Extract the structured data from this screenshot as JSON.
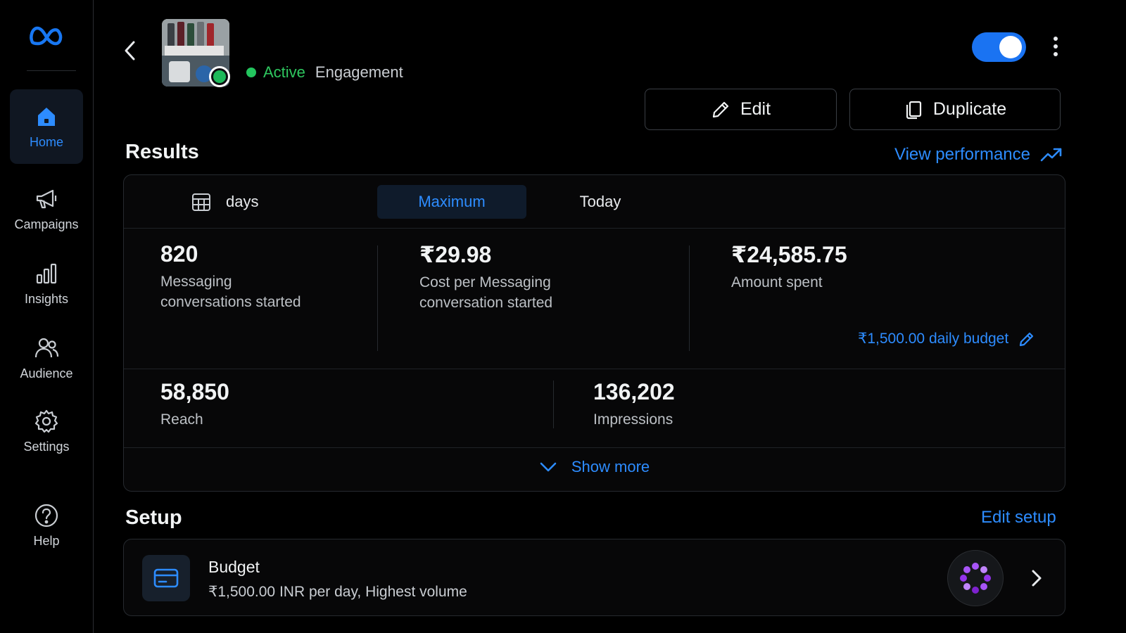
{
  "sidebar": {
    "items": [
      {
        "label": "Home",
        "icon": "home-icon"
      },
      {
        "label": "Campaigns",
        "icon": "megaphone-icon"
      },
      {
        "label": "Insights",
        "icon": "bar-chart-icon"
      },
      {
        "label": "Audience",
        "icon": "people-icon"
      },
      {
        "label": "Settings",
        "icon": "gear-icon"
      },
      {
        "label": "Help",
        "icon": "help-icon"
      }
    ]
  },
  "header": {
    "status": "Active",
    "objective": "Engagement",
    "toggle_on": true,
    "edit_label": "Edit",
    "duplicate_label": "Duplicate"
  },
  "results": {
    "title": "Results",
    "view_performance": "View performance",
    "tabs": [
      "days",
      "Maximum",
      "Today"
    ],
    "selected_tab": "Maximum",
    "metrics": {
      "messaging": {
        "value": "820",
        "label": "Messaging conversations started"
      },
      "cost": {
        "value": "₹29.98",
        "label": "Cost per Messaging conversation started"
      },
      "spent": {
        "value": "₹24,585.75",
        "label": "Amount spent"
      },
      "reach": {
        "value": "58,850",
        "label": "Reach"
      },
      "impressions": {
        "value": "136,202",
        "label": "Impressions"
      }
    },
    "daily_budget": "₹1,500.00 daily budget",
    "show_more": "Show more"
  },
  "setup": {
    "title": "Setup",
    "edit_setup": "Edit setup",
    "budget": {
      "name": "Budget",
      "detail": "₹1,500.00 INR per day, Highest volume"
    }
  },
  "colors": {
    "accent": "#2d8cff",
    "active_green": "#2ec75f",
    "toggle": "#1a73f2"
  }
}
